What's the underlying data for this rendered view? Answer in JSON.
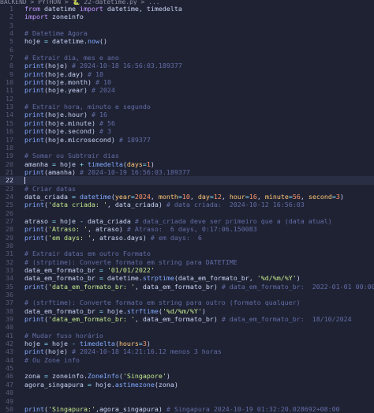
{
  "breadcrumb": "BACKEND > PYTHON > 🐍 22-datetime.py > ...",
  "lines": [
    [
      [
        "k",
        "from "
      ],
      [
        "v",
        "datetime "
      ],
      [
        "k",
        "import "
      ],
      [
        "v",
        "datetime"
      ],
      [
        "p",
        ", "
      ],
      [
        "v",
        "timedelta"
      ]
    ],
    [
      [
        "k",
        "import "
      ],
      [
        "v",
        "zoneinfo"
      ]
    ],
    [],
    [
      [
        "c",
        "# Datetime Agora"
      ]
    ],
    [
      [
        "v",
        "hoje "
      ],
      [
        "o",
        "= "
      ],
      [
        "v",
        "datetime"
      ],
      [
        "p",
        "."
      ],
      [
        "f",
        "now"
      ],
      [
        "p",
        "()"
      ]
    ],
    [],
    [
      [
        "c",
        "# Extrair dia, mes e ano"
      ]
    ],
    [
      [
        "f",
        "print"
      ],
      [
        "p",
        "("
      ],
      [
        "v",
        "hoje"
      ],
      [
        "p",
        ") "
      ],
      [
        "c",
        "# 2024-10-18 16:56:03.189377"
      ]
    ],
    [
      [
        "f",
        "print"
      ],
      [
        "p",
        "("
      ],
      [
        "v",
        "hoje"
      ],
      [
        "p",
        "."
      ],
      [
        "v",
        "day"
      ],
      [
        "p",
        ") "
      ],
      [
        "c",
        "# 18"
      ]
    ],
    [
      [
        "f",
        "print"
      ],
      [
        "p",
        "("
      ],
      [
        "v",
        "hoje"
      ],
      [
        "p",
        "."
      ],
      [
        "v",
        "month"
      ],
      [
        "p",
        ") "
      ],
      [
        "c",
        "# 10"
      ]
    ],
    [
      [
        "f",
        "print"
      ],
      [
        "p",
        "("
      ],
      [
        "v",
        "hoje"
      ],
      [
        "p",
        "."
      ],
      [
        "v",
        "year"
      ],
      [
        "p",
        ") "
      ],
      [
        "c",
        "# 2024"
      ]
    ],
    [],
    [
      [
        "c",
        "# Extrair hora, minuto e segundo"
      ]
    ],
    [
      [
        "f",
        "print"
      ],
      [
        "p",
        "("
      ],
      [
        "v",
        "hoje"
      ],
      [
        "p",
        "."
      ],
      [
        "v",
        "hour"
      ],
      [
        "p",
        ") "
      ],
      [
        "c",
        "# 16"
      ]
    ],
    [
      [
        "f",
        "print"
      ],
      [
        "p",
        "("
      ],
      [
        "v",
        "hoje"
      ],
      [
        "p",
        "."
      ],
      [
        "v",
        "minute"
      ],
      [
        "p",
        ") "
      ],
      [
        "c",
        "# 56"
      ]
    ],
    [
      [
        "f",
        "print"
      ],
      [
        "p",
        "("
      ],
      [
        "v",
        "hoje"
      ],
      [
        "p",
        "."
      ],
      [
        "v",
        "second"
      ],
      [
        "p",
        ") "
      ],
      [
        "c",
        "# 3"
      ]
    ],
    [
      [
        "f",
        "print"
      ],
      [
        "p",
        "("
      ],
      [
        "v",
        "hoje"
      ],
      [
        "p",
        "."
      ],
      [
        "v",
        "microsecond"
      ],
      [
        "p",
        ") "
      ],
      [
        "c",
        "# 189377"
      ]
    ],
    [],
    [
      [
        "c",
        "# Somar ou Subtrair dias"
      ]
    ],
    [
      [
        "v",
        "amanha "
      ],
      [
        "o",
        "= "
      ],
      [
        "v",
        "hoje "
      ],
      [
        "o",
        "+ "
      ],
      [
        "f",
        "timedelta"
      ],
      [
        "p",
        "("
      ],
      [
        "a",
        "days"
      ],
      [
        "o",
        "="
      ],
      [
        "n",
        "1"
      ],
      [
        "p",
        ")"
      ]
    ],
    [
      [
        "f",
        "print"
      ],
      [
        "p",
        "("
      ],
      [
        "v",
        "amanha"
      ],
      [
        "p",
        ") "
      ],
      [
        "c",
        "# 2024-10-19 16:56:03.189377"
      ]
    ],
    [],
    [
      [
        "c",
        "# Criar datas"
      ]
    ],
    [
      [
        "v",
        "data_criada "
      ],
      [
        "o",
        "= "
      ],
      [
        "f",
        "datetime"
      ],
      [
        "p",
        "("
      ],
      [
        "a",
        "year"
      ],
      [
        "o",
        "="
      ],
      [
        "n",
        "2024"
      ],
      [
        "p",
        ", "
      ],
      [
        "a",
        "month"
      ],
      [
        "o",
        "="
      ],
      [
        "n",
        "10"
      ],
      [
        "p",
        ", "
      ],
      [
        "a",
        "day"
      ],
      [
        "o",
        "="
      ],
      [
        "n",
        "12"
      ],
      [
        "p",
        ", "
      ],
      [
        "a",
        "hour"
      ],
      [
        "o",
        "="
      ],
      [
        "n",
        "16"
      ],
      [
        "p",
        ", "
      ],
      [
        "a",
        "minute"
      ],
      [
        "o",
        "="
      ],
      [
        "n",
        "56"
      ],
      [
        "p",
        ", "
      ],
      [
        "a",
        "second"
      ],
      [
        "o",
        "="
      ],
      [
        "n",
        "3"
      ],
      [
        "p",
        ")"
      ]
    ],
    [
      [
        "f",
        "print"
      ],
      [
        "p",
        "("
      ],
      [
        "s",
        "'data criada: '"
      ],
      [
        "p",
        ", "
      ],
      [
        "v",
        "data_criada"
      ],
      [
        "p",
        ") "
      ],
      [
        "c",
        "# data criada:  2024-10-12 16:56:03"
      ]
    ],
    [],
    [
      [
        "v",
        "atraso "
      ],
      [
        "o",
        "= "
      ],
      [
        "v",
        "hoje "
      ],
      [
        "o",
        "- "
      ],
      [
        "v",
        "data_criada "
      ],
      [
        "c",
        "# data_criada deve ser primeiro que a (data atual)"
      ]
    ],
    [
      [
        "f",
        "print"
      ],
      [
        "p",
        "("
      ],
      [
        "s",
        "'Atraso: '"
      ],
      [
        "p",
        ", "
      ],
      [
        "v",
        "atraso"
      ],
      [
        "p",
        ") "
      ],
      [
        "c",
        "# Atraso:  6 days, 0:17:06.150083"
      ]
    ],
    [
      [
        "f",
        "print"
      ],
      [
        "p",
        "("
      ],
      [
        "s",
        "'em days: '"
      ],
      [
        "p",
        ", "
      ],
      [
        "v",
        "atraso"
      ],
      [
        "p",
        "."
      ],
      [
        "v",
        "days"
      ],
      [
        "p",
        ") "
      ],
      [
        "c",
        "# em days:  6"
      ]
    ],
    [],
    [
      [
        "c",
        "# Extrair datas em outro Formato"
      ]
    ],
    [
      [
        "c",
        "# (strptime): Converte formato em string para DATETIME"
      ]
    ],
    [
      [
        "v",
        "data_em_formato_br "
      ],
      [
        "o",
        "= "
      ],
      [
        "s",
        "'01/01/2022'"
      ]
    ],
    [
      [
        "v",
        "data_em_formato_br "
      ],
      [
        "o",
        "= "
      ],
      [
        "v",
        "datetime"
      ],
      [
        "p",
        "."
      ],
      [
        "f",
        "strptime"
      ],
      [
        "p",
        "("
      ],
      [
        "v",
        "data_em_formato_br"
      ],
      [
        "p",
        ", "
      ],
      [
        "s",
        "'%d/%m/%Y'"
      ],
      [
        "p",
        ")"
      ]
    ],
    [
      [
        "f",
        "print"
      ],
      [
        "p",
        "("
      ],
      [
        "s",
        "'data_em_formato_br: '"
      ],
      [
        "p",
        ", "
      ],
      [
        "v",
        "data_em_formato_br"
      ],
      [
        "p",
        ") "
      ],
      [
        "c",
        "# data_em_formato_br:  2022-01-01 00:00:00"
      ]
    ],
    [],
    [
      [
        "c",
        "# (strftime): Converte formato em string para outro (formato qualquer)"
      ]
    ],
    [
      [
        "v",
        "data_em_formato_br "
      ],
      [
        "o",
        "= "
      ],
      [
        "v",
        "hoje"
      ],
      [
        "p",
        "."
      ],
      [
        "f",
        "strftime"
      ],
      [
        "p",
        "("
      ],
      [
        "s",
        "'%d/%m/%Y'"
      ],
      [
        "p",
        ")"
      ]
    ],
    [
      [
        "f",
        "print"
      ],
      [
        "p",
        "("
      ],
      [
        "s",
        "'data_em_formato_br: '"
      ],
      [
        "p",
        ", "
      ],
      [
        "v",
        "data_em_formato_br"
      ],
      [
        "p",
        ") "
      ],
      [
        "c",
        "# data_em_formato_br:  18/10/2024"
      ]
    ],
    [],
    [
      [
        "c",
        "# Mudar fuso horário"
      ]
    ],
    [
      [
        "v",
        "hoje "
      ],
      [
        "o",
        "= "
      ],
      [
        "v",
        "hoje "
      ],
      [
        "o",
        "- "
      ],
      [
        "f",
        "timedelta"
      ],
      [
        "p",
        "("
      ],
      [
        "a",
        "hours"
      ],
      [
        "o",
        "="
      ],
      [
        "n",
        "3"
      ],
      [
        "p",
        ")"
      ]
    ],
    [
      [
        "f",
        "print"
      ],
      [
        "p",
        "("
      ],
      [
        "v",
        "hoje"
      ],
      [
        "p",
        ") "
      ],
      [
        "c",
        "# 2024-10-18 14:21:16.12 menos 3 horas"
      ]
    ],
    [
      [
        "c",
        "# Ou Zone info"
      ]
    ],
    [],
    [
      [
        "v",
        "zona "
      ],
      [
        "o",
        "= "
      ],
      [
        "v",
        "zoneinfo"
      ],
      [
        "p",
        "."
      ],
      [
        "f",
        "ZoneInfo"
      ],
      [
        "p",
        "("
      ],
      [
        "s",
        "'Singapore'"
      ],
      [
        "p",
        ")"
      ]
    ],
    [
      [
        "v",
        "agora_singapura "
      ],
      [
        "o",
        "= "
      ],
      [
        "v",
        "hoje"
      ],
      [
        "p",
        "."
      ],
      [
        "f",
        "astimezone"
      ],
      [
        "p",
        "("
      ],
      [
        "v",
        "zona"
      ],
      [
        "p",
        ")"
      ]
    ],
    [],
    [],
    [
      [
        "f",
        "print"
      ],
      [
        "p",
        "("
      ],
      [
        "s",
        "'Singapura:'"
      ],
      [
        "p",
        ","
      ],
      [
        "v",
        "agora_singapura"
      ],
      [
        "p",
        ") "
      ],
      [
        "c",
        "# Singapura 2024-10-19 01:32:20.028692+08:00"
      ]
    ]
  ],
  "active_line": 22,
  "colors": {
    "background": "#1f2233",
    "comment": "#636da6",
    "keyword": "#c099ff",
    "function": "#82aaff",
    "string": "#c3e88d",
    "number": "#ff966c"
  }
}
